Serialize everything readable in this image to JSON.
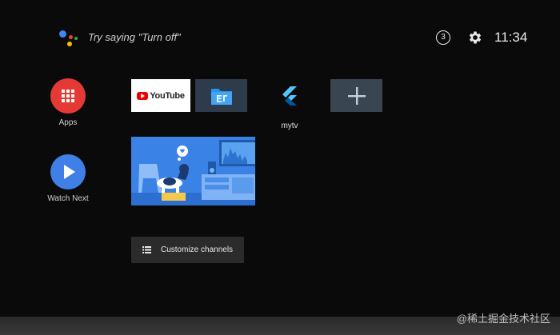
{
  "top_bar": {
    "assistant_prompt": "Try saying \"Turn off\"",
    "notification_count": "3",
    "clock": "11:34"
  },
  "rail": {
    "apps_label": "Apps",
    "watch_next_label": "Watch Next"
  },
  "apps_row": {
    "youtube_label": "YouTube",
    "mytv_label": "mytv"
  },
  "customize": {
    "label": "Customize channels"
  },
  "watermark": "@稀土掘金技术社区",
  "colors": {
    "apps_circle": "#e53935",
    "watch_next_circle": "#3f7fe6",
    "channel_card": "#3b82e6",
    "youtube_red": "#ee0000"
  }
}
